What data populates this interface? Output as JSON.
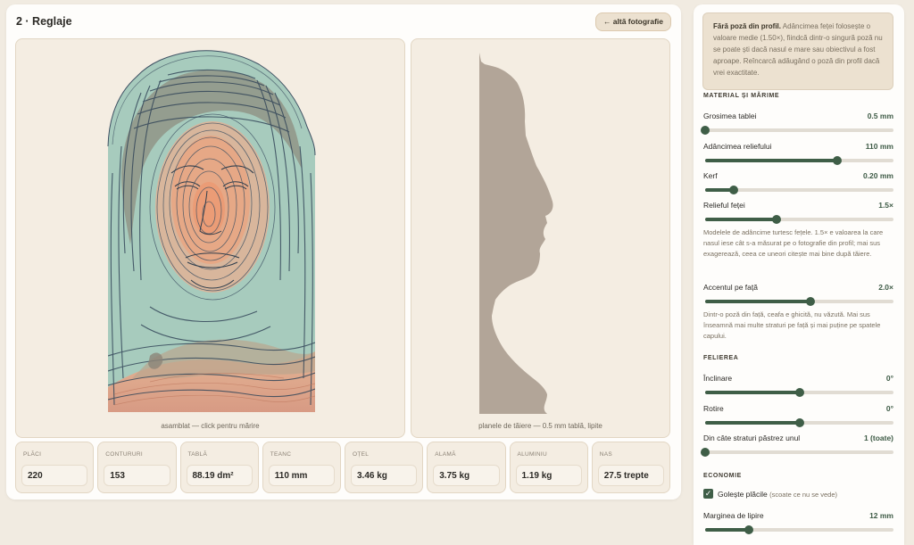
{
  "main": {
    "title": "2 · Reglaje",
    "other_photo_button": "← altă fotografie",
    "left_caption": "asamblat — click pentru mărire",
    "right_caption": "planele de tăiere — 0.5 mm tablă, lipite"
  },
  "stats": [
    {
      "label": "PLĂCI",
      "value": "220"
    },
    {
      "label": "CONTURURI",
      "value": "153"
    },
    {
      "label": "TABLĂ",
      "value": "88.19 dm²"
    },
    {
      "label": "TEANC",
      "value": "110 mm"
    },
    {
      "label": "OȚEL",
      "value": "3.46 kg"
    },
    {
      "label": "ALAMĂ",
      "value": "3.75 kg"
    },
    {
      "label": "ALUMINIU",
      "value": "1.19 kg"
    },
    {
      "label": "NAS",
      "value": "27.5 trepte"
    }
  ],
  "sidebar": {
    "notice_title": "Fără poză din profil.",
    "notice_body": "Adâncimea feței folosește o valoare medie (1.50×), fiindcă dintr-o singură poză nu se poate ști dacă nasul e mare sau obiectivul a fost aproape. Reîncarcă adăugând o poză din profil dacă vrei exactitate.",
    "sections": {
      "material": "MATERIAL ȘI MĂRIME",
      "slicing": "FELIEREA",
      "economy": "ECONOMIE"
    },
    "controls": {
      "thickness": {
        "label": "Grosimea tablei",
        "value": "0.5 mm",
        "level": 0.0
      },
      "depth": {
        "label": "Adâncimea reliefului",
        "value": "110 mm",
        "level": 0.7
      },
      "kerf": {
        "label": "Kerf",
        "value": "0.20 mm",
        "level": 0.15
      },
      "relief": {
        "label": "Relieful feței",
        "value": "1.5×",
        "level": 0.38
      },
      "relief_help": "Modelele de adâncime turtesc fețele. 1.5× e valoarea la care nasul iese cât s-a măsurat pe o fotografie din profil; mai sus exagerează, ceea ce uneori citește mai bine după tăiere.",
      "face_accent": {
        "label": "Accentul pe față",
        "value": "2.0×",
        "level": 0.56
      },
      "face_accent_help": "Dintr-o poză din față, ceafa e ghicită, nu văzută. Mai sus înseamnă mai multe straturi pe față și mai puține pe spatele capului.",
      "tilt": {
        "label": "Înclinare",
        "value": "0°",
        "level": 0.5
      },
      "rotation": {
        "label": "Rotire",
        "value": "0°",
        "level": 0.5
      },
      "keep_layers": {
        "label": "Din câte straturi păstrez unul",
        "value": "1 (toate)",
        "level": 0.0
      },
      "hollow": {
        "label": "Golește plăcile",
        "hint": "(scoate ce nu se vede)",
        "checked": true
      },
      "glue_margin": {
        "label": "Marginea de lipire",
        "value": "12 mm",
        "level": 0.23
      }
    }
  },
  "colors": {
    "accent": "#3f5e47",
    "relief_teal": "#a7cbbd",
    "contour_dark": "#3e5163",
    "warm_peach": "#e7a17e",
    "profile_gray": "#b2a598"
  }
}
